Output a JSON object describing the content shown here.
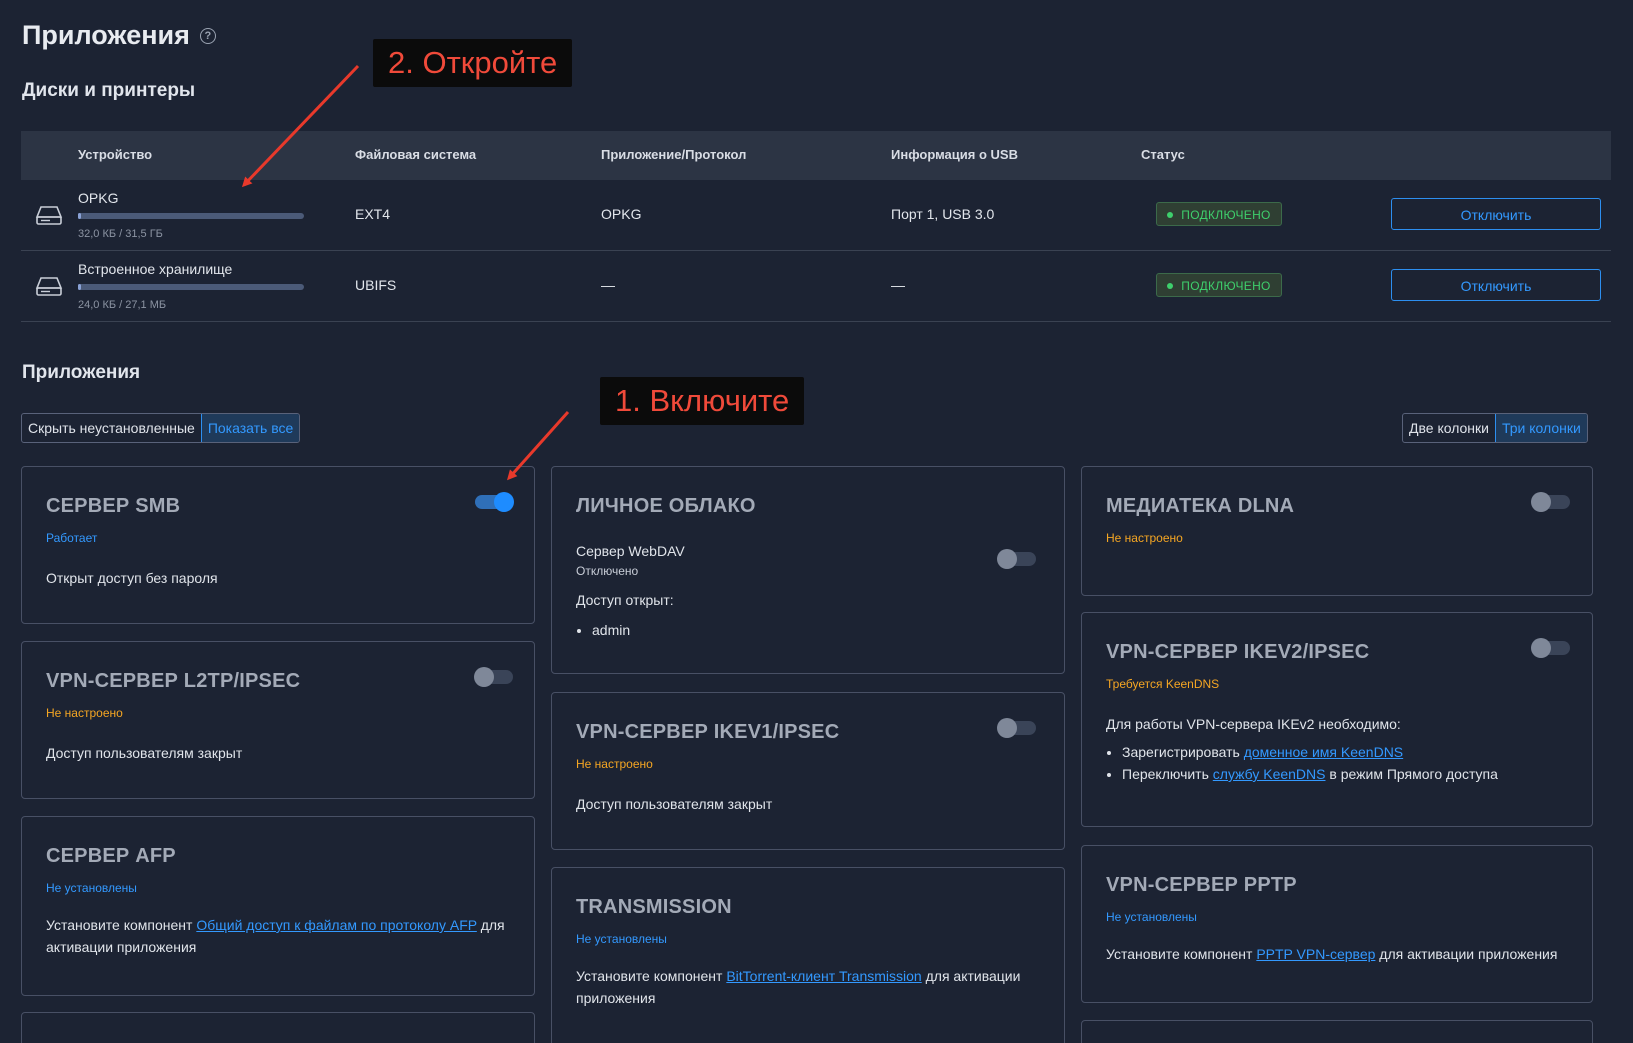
{
  "page": {
    "title": "Приложения",
    "help": "?"
  },
  "disks": {
    "section_title": "Диски и принтеры",
    "columns": [
      "Устройство",
      "Файловая система",
      "Приложение/Протокол",
      "Информация о USB",
      "Статус"
    ],
    "rows": [
      {
        "name": "OPKG",
        "usage_fraction": 0.001,
        "size": "32,0 КБ / 31,5 ГБ",
        "fs": "EXT4",
        "app": "OPKG",
        "usb": "Порт 1, USB 3.0",
        "status": "ПОДКЛЮЧЕНО",
        "action": "Отключить"
      },
      {
        "name": "Встроенное хранилище",
        "usage_fraction": 0.001,
        "size": "24,0 КБ / 27,1 МБ",
        "fs": "UBIFS",
        "app": "—",
        "usb": "—",
        "status": "ПОДКЛЮЧЕНО",
        "action": "Отключить"
      }
    ]
  },
  "apps": {
    "section_title": "Приложения",
    "filter": {
      "hide": "Скрыть неустановленные",
      "show": "Показать все"
    },
    "layout": {
      "two": "Две колонки",
      "three": "Три колонки"
    },
    "cards": {
      "smb": {
        "title": "СЕРВЕР SMB",
        "state": "Работает",
        "text": "Открыт доступ без пароля",
        "enabled": true
      },
      "l2tp": {
        "title": "VPN-СЕРВЕР L2TP/IPSEC",
        "state": "Не настроено",
        "text": "Доступ пользователям закрыт",
        "enabled": false
      },
      "afp": {
        "title": "СЕРВЕР AFP",
        "state": "Не установлены",
        "text_before": "Установите компонент ",
        "link": "Общий доступ к файлам по протоколу AFP",
        "text_after": " для активации приложения"
      },
      "cloud": {
        "title": "ЛИЧНОЕ ОБЛАКО",
        "webdav_label": "Сервер WebDAV",
        "webdav_state": "Отключено",
        "access_label": "Доступ открыт:",
        "users": [
          "admin"
        ],
        "enabled": false
      },
      "ikev1": {
        "title": "VPN-СЕРВЕР IKEV1/IPSEC",
        "state": "Не настроено",
        "text": "Доступ пользователям закрыт",
        "enabled": false
      },
      "transmission": {
        "title": "TRANSMISSION",
        "state": "Не установлены",
        "text_before": "Установите компонент ",
        "link": "BitTorrent-клиент Transmission",
        "text_after": " для активации приложения"
      },
      "dlna": {
        "title": "МЕДИАТЕКА DLNA",
        "state": "Не настроено",
        "enabled": false
      },
      "ikev2": {
        "title": "VPN-СЕРВЕР IKEV2/IPSEC",
        "state": "Требуется KeenDNS",
        "intro": "Для работы VPN-сервера IKEv2 необходимо:",
        "item1_before": "Зарегистрировать ",
        "item1_link": "доменное имя KeenDNS",
        "item2_before": "Переключить ",
        "item2_link": "службу KeenDNS",
        "item2_after": " в режим Прямого доступа",
        "enabled": false
      },
      "pptp": {
        "title": "VPN-СЕРВЕР PPTP",
        "state": "Не установлены",
        "text_before": "Установите компонент ",
        "link": "PPTP VPN-сервер",
        "text_after": " для активации приложения"
      }
    }
  },
  "annotations": {
    "open": "2. Откройте",
    "enable": "1. Включите"
  },
  "colors": {
    "accent": "#3399ff",
    "ok": "#3ecf6c",
    "warn": "#f5a623",
    "annotation": "#f04a3a"
  }
}
